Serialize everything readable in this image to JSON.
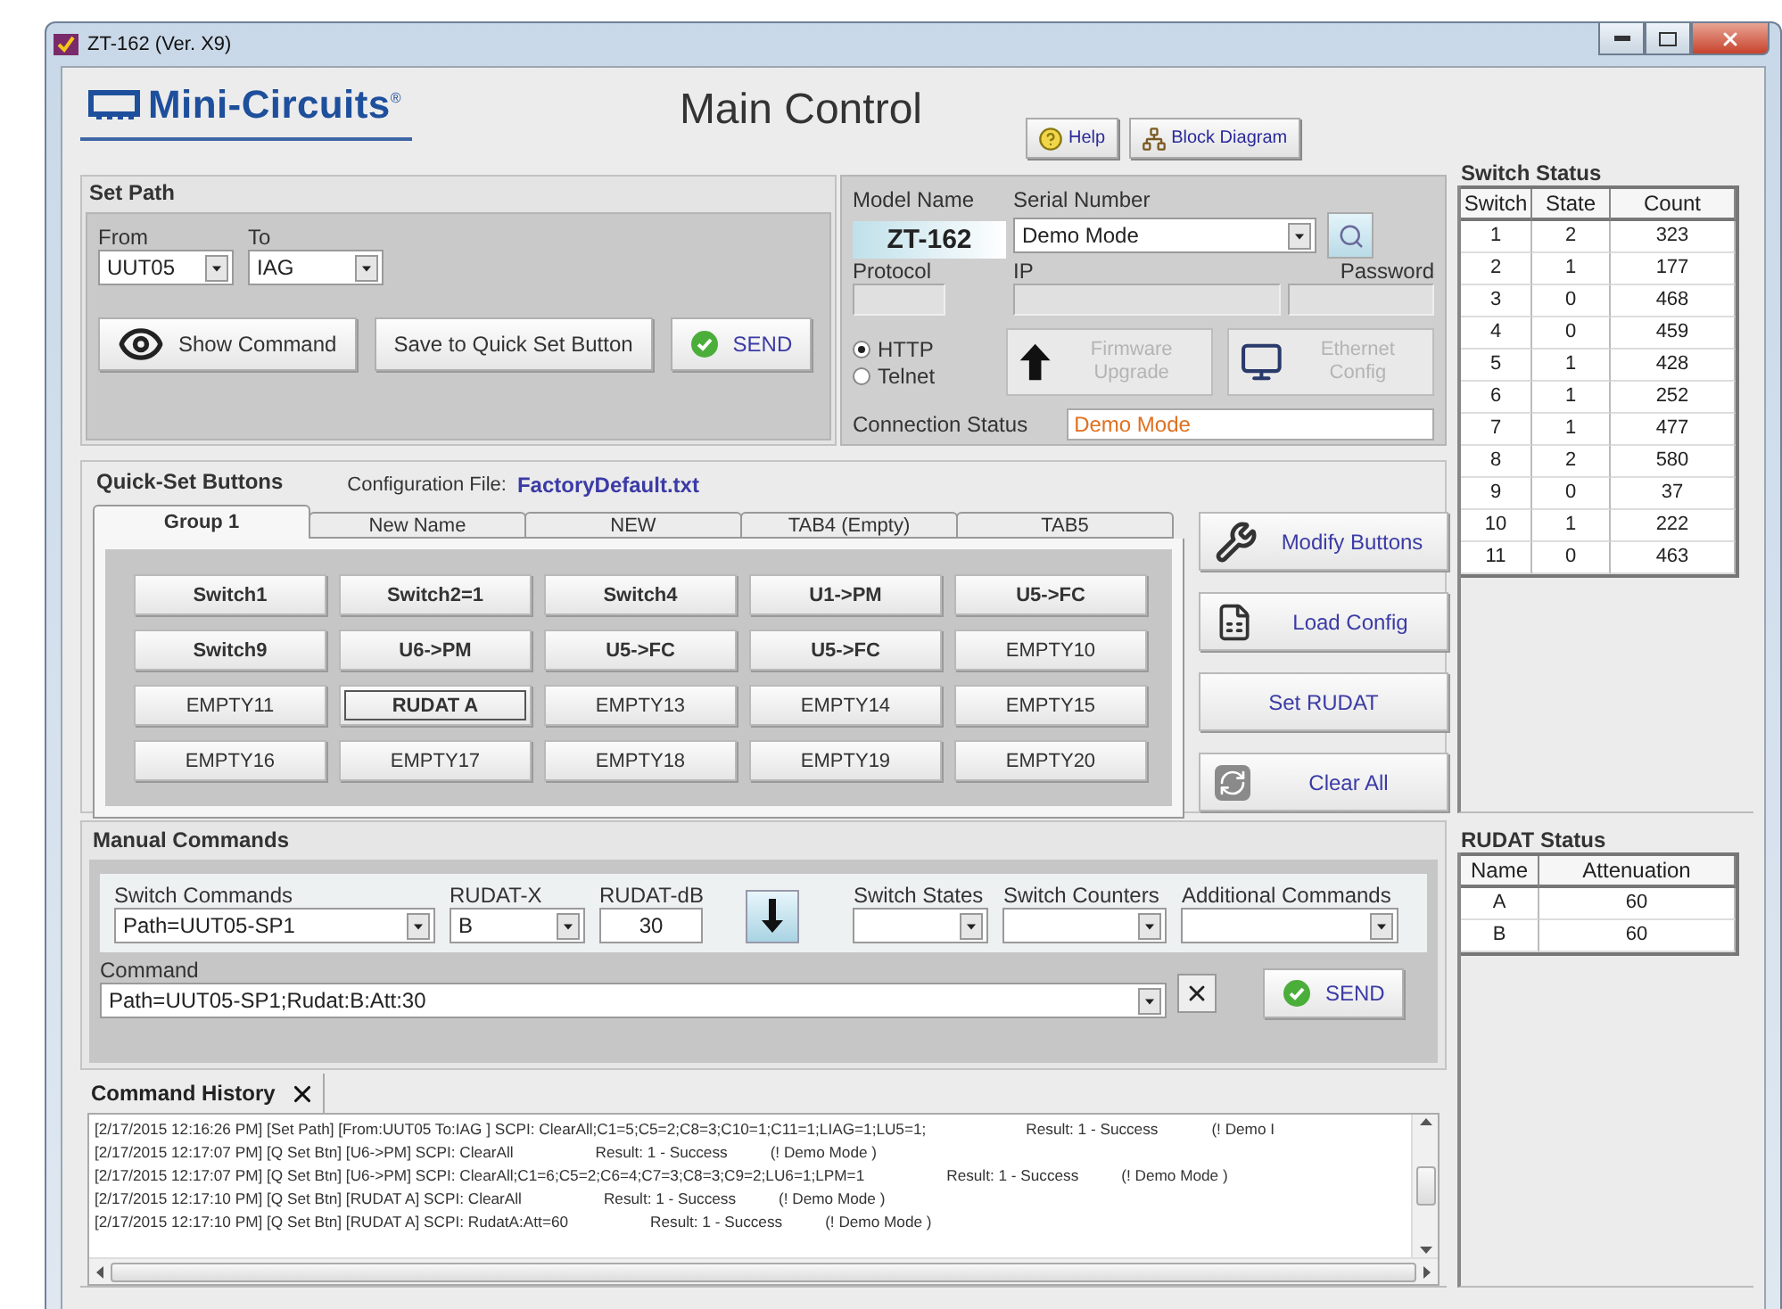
{
  "window": {
    "title": "ZT-162 (Ver. X9)"
  },
  "header": {
    "logo": "Mini-Circuits$^{®}$",
    "title": "Main Control",
    "buttons": [
      {
        "label": "Help",
        "kind": "help"
      },
      {
        "label": "Block Diagram",
        "kind": "diagram"
      }
    ]
  },
  "set_path": {
    "title": "Set Path",
    "from": {
      "label": "From",
      "value": "UUT05"
    },
    "to": {
      "label": "To",
      "value": "IAG"
    },
    "buttons": [
      {
        "label": "Show Command",
        "kind": "show"
      },
      {
        "label": "Save to Quick Set Button",
        "kind": "plain"
      },
      {
        "label": "SEND",
        "kind": "send"
      }
    ]
  },
  "connection": {
    "model_label": "Model Name",
    "model": "ZT-162",
    "serial_label": "Serial Number",
    "serial": "Demo Mode",
    "protocol_label": "Protocol",
    "ip_label": "IP",
    "password_label": "Password",
    "protocols": [
      {
        "label": "HTTP",
        "selected": true
      },
      {
        "label": "Telnet",
        "selected": false
      }
    ],
    "actions": [
      {
        "label": "Firmware Upgrade",
        "kind": "firmware",
        "disabled": true
      },
      {
        "label": "Ethernet Config",
        "kind": "ethernet",
        "disabled": true
      }
    ],
    "status_label": "Connection Status",
    "status": "Demo Mode"
  },
  "quick_set": {
    "title": "Quick-Set Buttons",
    "config_label": "Configuration File:",
    "config_file": "FactoryDefault.txt",
    "tabs": [
      {
        "label": "Group 1",
        "selected": true
      },
      {
        "label": "New Name",
        "selected": false
      },
      {
        "label": "NEW",
        "selected": false
      },
      {
        "label": "TAB4 (Empty)",
        "selected": false
      },
      {
        "label": "TAB5",
        "selected": false
      }
    ],
    "buttons": [
      {
        "label": "Switch1",
        "assigned": true,
        "focused": false
      },
      {
        "label": "Switch2=1",
        "assigned": true,
        "focused": false
      },
      {
        "label": "Switch4",
        "assigned": true,
        "focused": false
      },
      {
        "label": "U1->PM",
        "assigned": true,
        "focused": false
      },
      {
        "label": "U5->FC",
        "assigned": true,
        "focused": false
      },
      {
        "label": "Switch9",
        "assigned": true,
        "focused": false
      },
      {
        "label": "U6->PM",
        "assigned": true,
        "focused": false
      },
      {
        "label": "U5->FC",
        "assigned": true,
        "focused": false
      },
      {
        "label": "U5->FC",
        "assigned": true,
        "focused": false
      },
      {
        "label": "EMPTY10",
        "assigned": false,
        "focused": false
      },
      {
        "label": "EMPTY11",
        "assigned": false,
        "focused": false
      },
      {
        "label": "RUDAT A",
        "assigned": true,
        "focused": true
      },
      {
        "label": "EMPTY13",
        "assigned": false,
        "focused": false
      },
      {
        "label": "EMPTY14",
        "assigned": false,
        "focused": false
      },
      {
        "label": "EMPTY15",
        "assigned": false,
        "focused": false
      },
      {
        "label": "EMPTY16",
        "assigned": false,
        "focused": false
      },
      {
        "label": "EMPTY17",
        "assigned": false,
        "focused": false
      },
      {
        "label": "EMPTY18",
        "assigned": false,
        "focused": false
      },
      {
        "label": "EMPTY19",
        "assigned": false,
        "focused": false
      },
      {
        "label": "EMPTY20",
        "assigned": false,
        "focused": false
      }
    ],
    "side_buttons": [
      {
        "label": "Modify Buttons",
        "kind": "modify"
      },
      {
        "label": "Load Config",
        "kind": "load"
      },
      {
        "label": "Set RUDAT",
        "kind": "rudat"
      },
      {
        "label": "Clear All",
        "kind": "clear"
      }
    ]
  },
  "manual": {
    "title": "Manual Commands",
    "switch_commands": {
      "label": "Switch Commands",
      "value": "Path=UUT05-SP1"
    },
    "rudat_x": {
      "label": "RUDAT-X",
      "value": "B"
    },
    "rudat_db": {
      "label": "RUDAT-dB",
      "value": "30"
    },
    "selectors": [
      {
        "label": "Switch States"
      },
      {
        "label": "Switch Counters"
      },
      {
        "label": "Additional Commands"
      }
    ],
    "command": {
      "label": "Command",
      "value": "Path=UUT05-SP1;Rudat:B:Att:30"
    },
    "send": "SEND"
  },
  "history": {
    "title": "Command History",
    "lines": [
      {
        "entry": "[2/17/2015 12:16:26 PM] [Set Path] [From:UUT05 To:IAG ] SCPI: ClearAll;C1=5;C5=2;C8=3;C10=1;C11=1;LIAG=1;LU5=1;",
        "result": "Result: 1 - Success",
        "note": "(! Demo I"
      },
      {
        "entry": "[2/17/2015 12:17:07 PM] [Q Set Btn] [U6->PM] SCPI: ClearAll",
        "result": "Result: 1 - Success",
        "note": "(! Demo Mode )"
      },
      {
        "entry": "[2/17/2015 12:17:07 PM] [Q Set Btn] [U6->PM] SCPI: ClearAll;C1=6;C5=2;C6=4;C7=3;C8=3;C9=2;LU6=1;LPM=1",
        "result": "Result: 1 - Success",
        "note": "(! Demo Mode )"
      },
      {
        "entry": "[2/17/2015 12:17:10 PM] [Q Set Btn] [RUDAT A] SCPI: ClearAll",
        "result": "Result: 1 - Success",
        "note": "(! Demo Mode )"
      },
      {
        "entry": "[2/17/2015 12:17:10 PM] [Q Set Btn] [RUDAT A] SCPI: RudatA:Att=60",
        "result": "Result: 1 - Success",
        "note": "(! Demo Mode )"
      }
    ]
  },
  "switch_status": {
    "title": "Switch Status",
    "columns": [
      "Switch",
      "State",
      "Count"
    ],
    "rows": [
      [
        "1",
        "2",
        "323"
      ],
      [
        "2",
        "1",
        "177"
      ],
      [
        "3",
        "0",
        "468"
      ],
      [
        "4",
        "0",
        "459"
      ],
      [
        "5",
        "1",
        "428"
      ],
      [
        "6",
        "1",
        "252"
      ],
      [
        "7",
        "1",
        "477"
      ],
      [
        "8",
        "2",
        "580"
      ],
      [
        "9",
        "0",
        "37"
      ],
      [
        "10",
        "1",
        "222"
      ],
      [
        "11",
        "0",
        "463"
      ]
    ]
  },
  "rudat_status": {
    "title": "RUDAT Status",
    "columns": [
      "Name",
      "Attenuation"
    ],
    "rows": [
      [
        "A",
        "60"
      ],
      [
        "B",
        "60"
      ]
    ]
  }
}
